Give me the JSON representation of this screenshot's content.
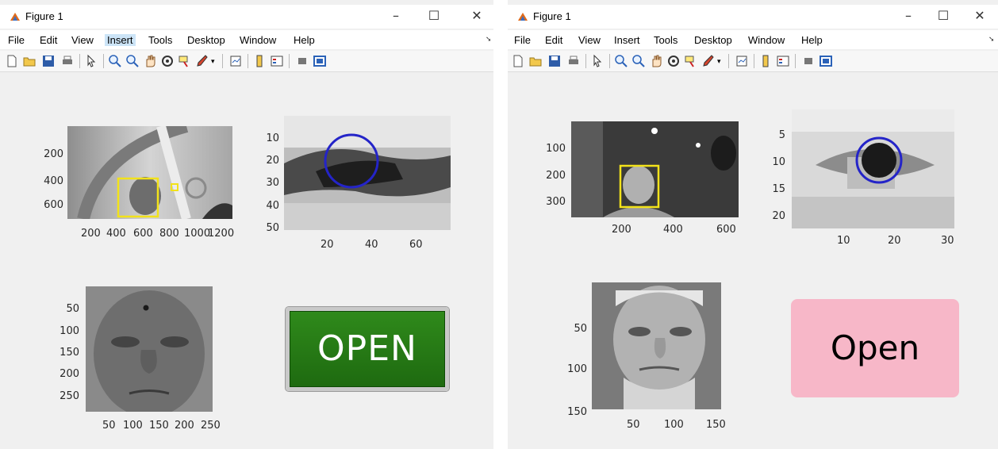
{
  "windows": [
    {
      "title": "Figure 1",
      "menu": [
        "File",
        "Edit",
        "View",
        "Insert",
        "Tools",
        "Desktop",
        "Window",
        "Help"
      ],
      "controls": {
        "minimize": "–",
        "maximize": "☐",
        "close": "✕"
      },
      "scene_plot": {
        "x_ticks": [
          "200",
          "400",
          "600",
          "800",
          "1000",
          "1200"
        ],
        "y_ticks": [
          "200",
          "400",
          "600"
        ]
      },
      "eye_plot": {
        "x_ticks": [
          "20",
          "40",
          "60"
        ],
        "y_ticks": [
          "10",
          "20",
          "30",
          "40",
          "50"
        ]
      },
      "face_plot": {
        "x_ticks": [
          "50",
          "100",
          "150",
          "200",
          "250"
        ],
        "y_ticks": [
          "50",
          "100",
          "150",
          "200",
          "250"
        ]
      },
      "status_button": {
        "label": "OPEN",
        "color": "#1f7a12"
      }
    },
    {
      "title": "Figure 1",
      "menu": [
        "File",
        "Edit",
        "View",
        "Insert",
        "Tools",
        "Desktop",
        "Window",
        "Help"
      ],
      "controls": {
        "minimize": "–",
        "maximize": "☐",
        "close": "✕"
      },
      "scene_plot": {
        "x_ticks": [
          "200",
          "400",
          "600"
        ],
        "y_ticks": [
          "100",
          "200",
          "300"
        ]
      },
      "eye_plot": {
        "x_ticks": [
          "10",
          "20",
          "30"
        ],
        "y_ticks": [
          "5",
          "10",
          "15",
          "20"
        ]
      },
      "face_plot": {
        "x_ticks": [
          "50",
          "100",
          "150"
        ],
        "y_ticks": [
          "50",
          "100",
          "150"
        ]
      },
      "status_button": {
        "label": "Open",
        "color": "#f7b7c8"
      }
    }
  ],
  "accent": {
    "detection_box": "#f2e21a",
    "eye_circle": "#2424c8"
  },
  "toolbar_icons": [
    "new-file-icon",
    "open-folder-icon",
    "save-icon",
    "print-icon",
    "pointer-icon",
    "zoom-in-icon",
    "zoom-out-icon",
    "pan-icon",
    "rotate-icon",
    "data-cursor-icon",
    "brush-icon",
    "link-plot-icon",
    "colorbar-icon",
    "legend-icon",
    "hide-plot-tools-icon",
    "show-plot-tools-icon"
  ]
}
